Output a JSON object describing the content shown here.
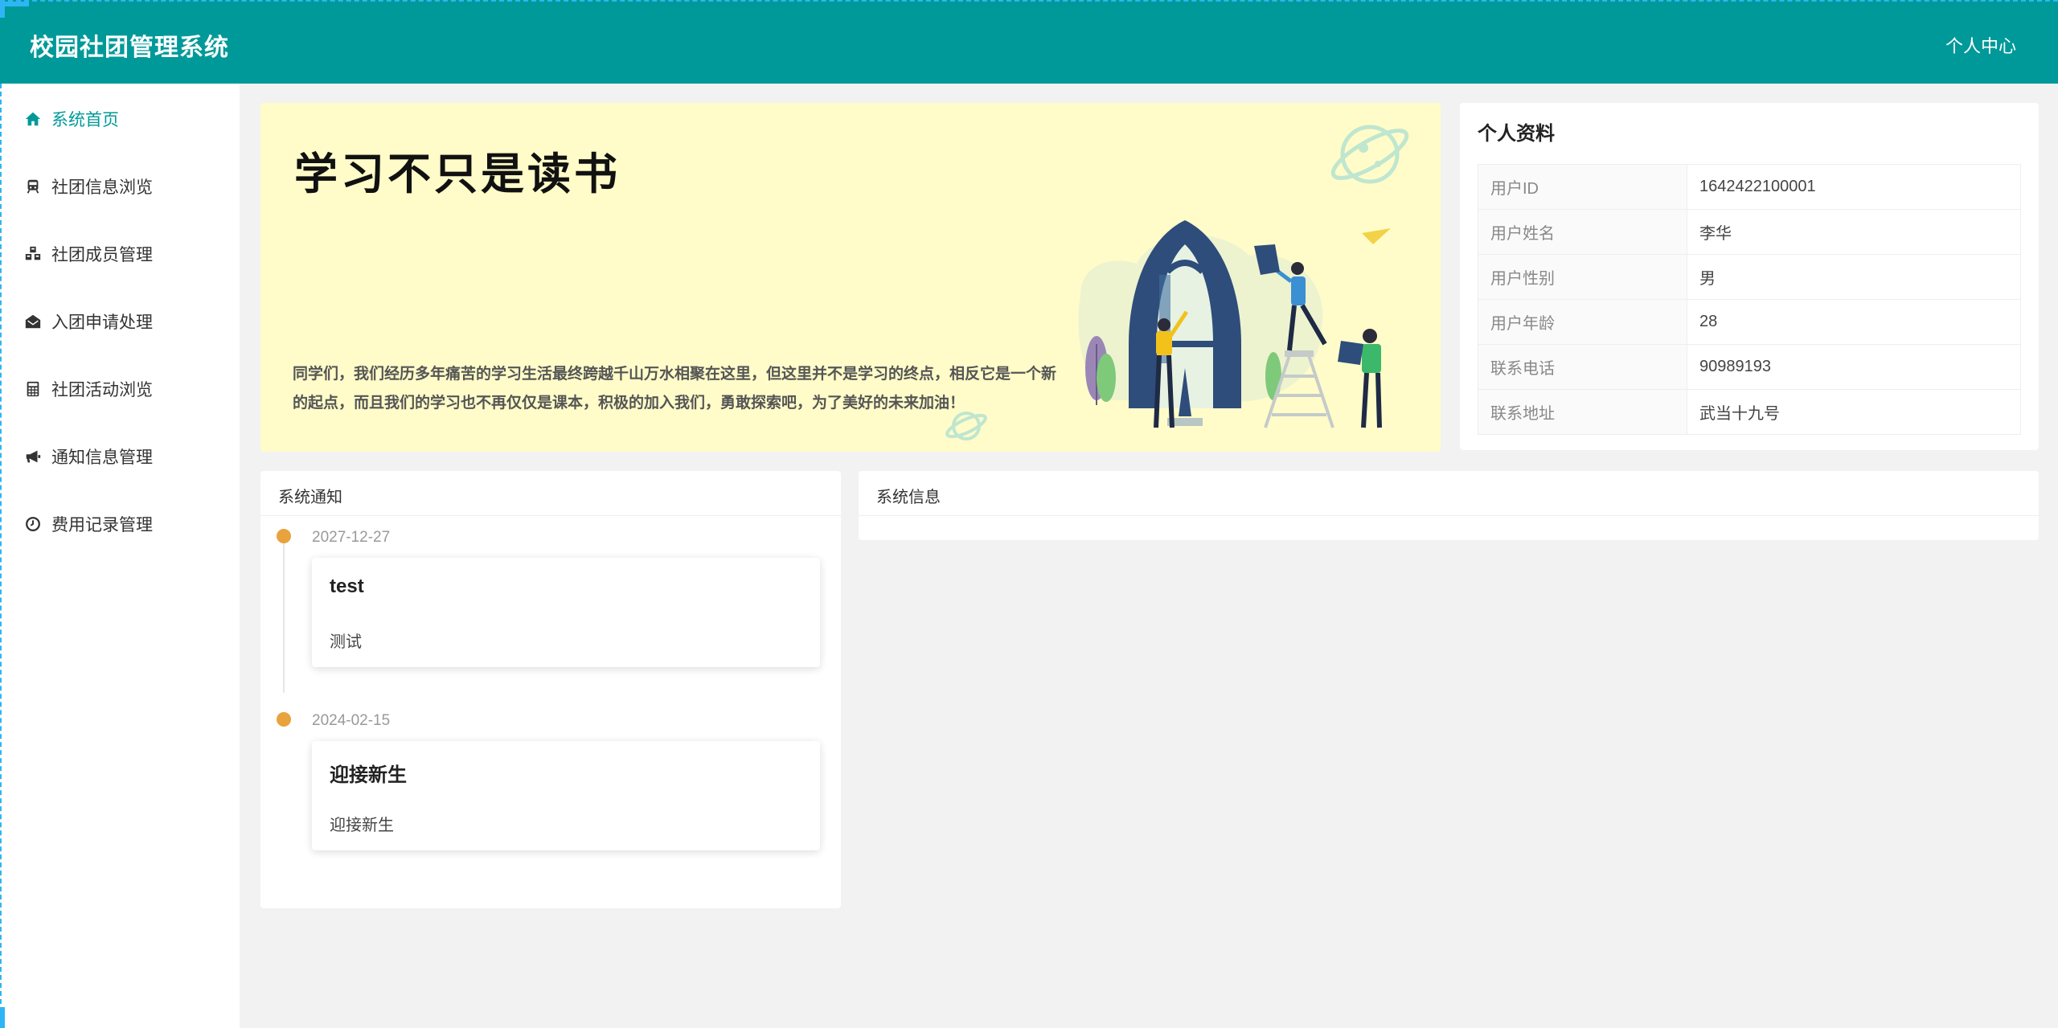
{
  "header": {
    "brand": "校园社团管理系统",
    "user_center": "个人中心",
    "bg_color": "#009999"
  },
  "sidebar": {
    "items": [
      {
        "label": "系统首页",
        "icon": "home-icon",
        "active": true
      },
      {
        "label": "社团信息浏览",
        "icon": "train-icon",
        "active": false
      },
      {
        "label": "社团成员管理",
        "icon": "cubes-icon",
        "active": false
      },
      {
        "label": "入团申请处理",
        "icon": "envelope-open-icon",
        "active": false
      },
      {
        "label": "社团活动浏览",
        "icon": "calculator-icon",
        "active": false
      },
      {
        "label": "通知信息管理",
        "icon": "bullhorn-icon",
        "active": false
      },
      {
        "label": "费用记录管理",
        "icon": "clock-icon",
        "active": false
      }
    ]
  },
  "banner": {
    "title": "学习不只是读书",
    "text": "同学们，我们经历多年痛苦的学习生活最终跨越千山万水相聚在这里，但这里并不是学习的终点，相反它是一个新的起点，而且我们的学习也不再仅仅是课本，积极的加入我们，勇敢探索吧，为了美好的未来加油！",
    "bg_color": "#fffcc9"
  },
  "profile": {
    "title": "个人资料",
    "rows": [
      {
        "key": "用户ID",
        "value": "1642422100001"
      },
      {
        "key": "用户姓名",
        "value": "李华"
      },
      {
        "key": "用户性别",
        "value": "男"
      },
      {
        "key": "用户年龄",
        "value": "28"
      },
      {
        "key": "联系电话",
        "value": "90989193"
      },
      {
        "key": "联系地址",
        "value": "武当十九号"
      }
    ]
  },
  "notices": {
    "title": "系统通知",
    "items": [
      {
        "date": "2027-12-27",
        "title": "test",
        "content": "测试"
      },
      {
        "date": "2024-02-15",
        "title": "迎接新生",
        "content": "迎接新生"
      }
    ]
  },
  "sysinfo": {
    "title": "系统信息"
  },
  "colors": {
    "accent": "#009999",
    "timeline_dot": "#e8a33d",
    "page_bg": "#f2f2f2"
  }
}
